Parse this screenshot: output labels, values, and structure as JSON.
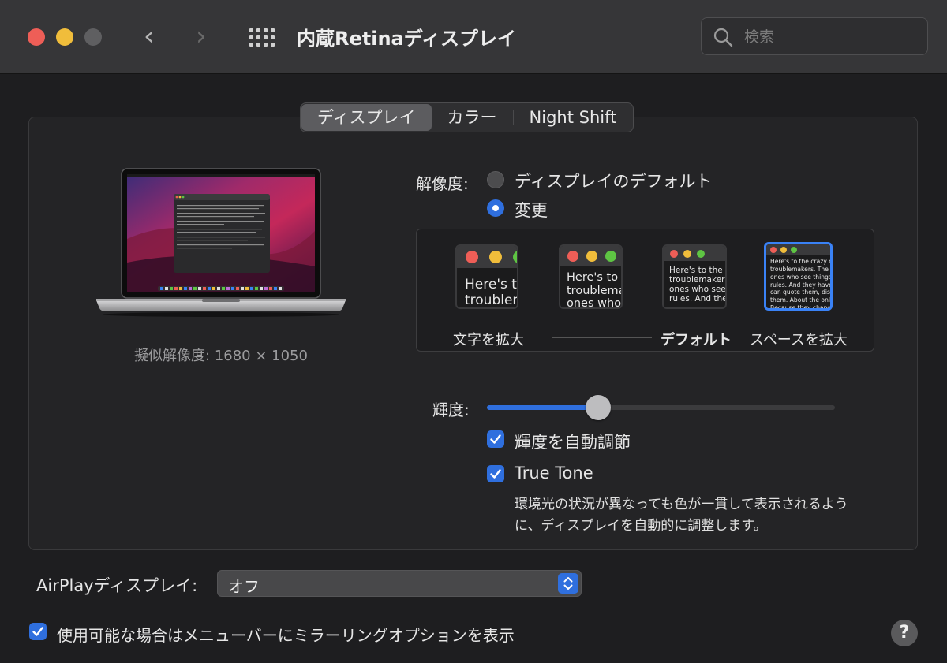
{
  "window": {
    "title": "内蔵Retinaディスプレイ",
    "search_placeholder": "検索"
  },
  "tabs": [
    {
      "label": "ディスプレイ",
      "active": true
    },
    {
      "label": "カラー",
      "active": false
    },
    {
      "label": "Night Shift",
      "active": false
    }
  ],
  "preview": {
    "simulated_resolution": "擬似解像度: 1680 × 1050"
  },
  "resolution": {
    "label": "解像度:",
    "options": [
      {
        "label": "ディスプレイのデフォルト",
        "selected": false
      },
      {
        "label": "変更",
        "selected": true
      }
    ]
  },
  "scaling": {
    "thumbnails": [
      {
        "text": "Here's to t\ntroublem",
        "selected": false
      },
      {
        "text": "Here's to t\ntroublema\nones who",
        "selected": false
      },
      {
        "text": "Here's to the cr\ntroublemakers.\nones who see t\nrules. And they",
        "selected": false
      },
      {
        "text": "Here's to the crazy ones\ntroublemakers. The rou\nones who see things dif\nrules. And they have no\ncan quote them, disagr\nthem. About the only th\nBecause they change th",
        "selected": true
      }
    ],
    "labels": {
      "larger_text": "文字を拡大",
      "default": "デフォルト",
      "more_space": "スペースを拡大"
    }
  },
  "brightness": {
    "label": "輝度:",
    "level": 0.32,
    "auto_label": "輝度を自動調節",
    "auto_checked": true
  },
  "true_tone": {
    "label": "True Tone",
    "checked": true,
    "description": "環境光の状況が異なっても色が一貫して表示されるように、ディスプレイを自動的に調整します。"
  },
  "airplay": {
    "label": "AirPlayディスプレイ:",
    "value": "オフ"
  },
  "mirroring": {
    "label": "使用可能な場合はメニューバーにミラーリングオプションを表示",
    "checked": true
  },
  "help": {
    "label": "?"
  },
  "colors": {
    "accent": "#2f6fde",
    "selection": "#3a82f6",
    "close": "#ee5e57",
    "minimize": "#f0bd3b",
    "zoom_disabled": "#5f5f61"
  }
}
